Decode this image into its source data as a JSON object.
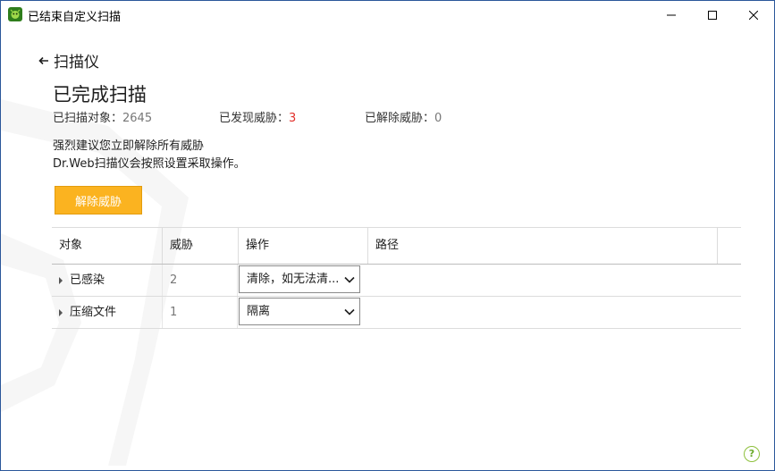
{
  "window": {
    "title": "已结束自定义扫描"
  },
  "nav": {
    "back_label": "扫描仪"
  },
  "page": {
    "heading": "已完成扫描",
    "stats": [
      {
        "label": "已扫描对象：",
        "value": "2645"
      },
      {
        "label": "已发现威胁：",
        "value": "3"
      },
      {
        "label": "已解除威胁：",
        "value": "0"
      }
    ],
    "message_line1": "强烈建议您立即解除所有威胁",
    "message_line2": "Dr.Web扫描仪会按照设置采取操作。",
    "fix_button": "解除威胁"
  },
  "table": {
    "columns": [
      "对象",
      "威胁",
      "操作",
      "路径"
    ],
    "rows": [
      {
        "name": "已感染",
        "count": "2",
        "action": "清除，如无法清..."
      },
      {
        "name": "压缩文件",
        "count": "1",
        "action": "隔离"
      }
    ]
  },
  "colors": {
    "accent": "#fbb320",
    "threat_red": "#e2302b",
    "help_green": "#6aaa2a"
  },
  "icons": {
    "app": "drweb-spider-icon",
    "back": "arrow-left-icon",
    "help": "help-icon",
    "dropdown": "chevron-down-icon"
  }
}
